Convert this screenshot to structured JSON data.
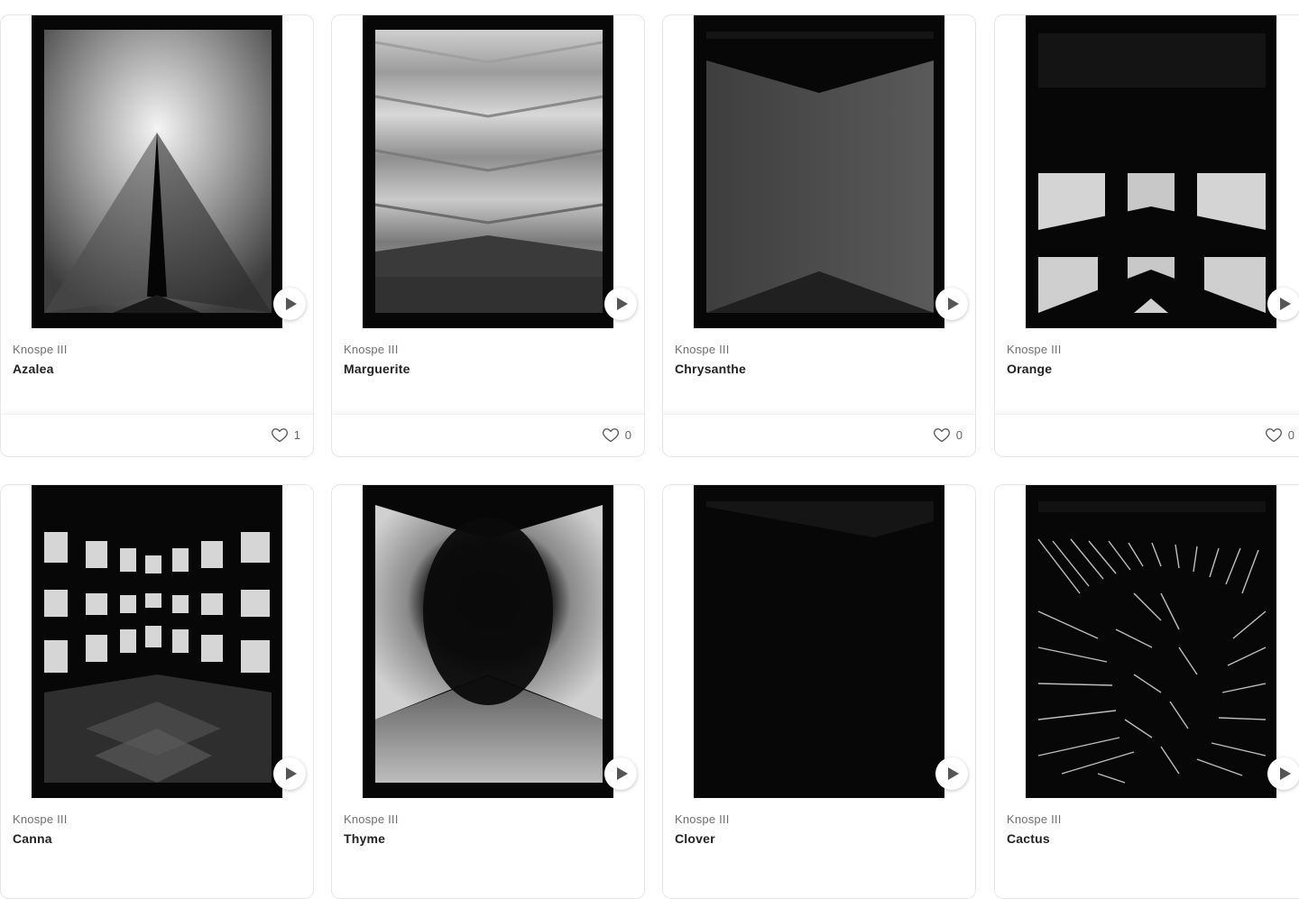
{
  "cards": [
    {
      "collection": "Knospe III",
      "title": "Azalea",
      "likes": "1",
      "art": "azalea"
    },
    {
      "collection": "Knospe III",
      "title": "Marguerite",
      "likes": "0",
      "art": "marguerite"
    },
    {
      "collection": "Knospe III",
      "title": "Chrysanthe",
      "likes": "0",
      "art": "chrysanthe"
    },
    {
      "collection": "Knospe III",
      "title": "Orange",
      "likes": "0",
      "art": "orange"
    },
    {
      "collection": "Knospe III",
      "title": "Canna",
      "likes": "",
      "art": "canna"
    },
    {
      "collection": "Knospe III",
      "title": "Thyme",
      "likes": "",
      "art": "thyme"
    },
    {
      "collection": "Knospe III",
      "title": "Clover",
      "likes": "",
      "art": "clover"
    },
    {
      "collection": "Knospe III",
      "title": "Cactus",
      "likes": "",
      "art": "cactus"
    }
  ],
  "icons": {
    "play": "play-icon",
    "like": "heart-icon"
  },
  "colors": {
    "frame": "#070707",
    "card_border": "#e6e6e6",
    "text_title": "#222222",
    "text_meta": "#707070"
  }
}
